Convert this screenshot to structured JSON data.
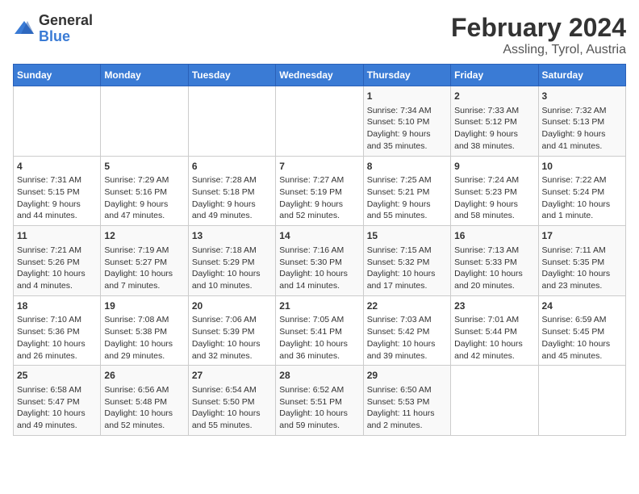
{
  "header": {
    "logo_general": "General",
    "logo_blue": "Blue",
    "title": "February 2024",
    "subtitle": "Assling, Tyrol, Austria"
  },
  "days_of_week": [
    "Sunday",
    "Monday",
    "Tuesday",
    "Wednesday",
    "Thursday",
    "Friday",
    "Saturday"
  ],
  "weeks": [
    [
      {
        "day": "",
        "info": ""
      },
      {
        "day": "",
        "info": ""
      },
      {
        "day": "",
        "info": ""
      },
      {
        "day": "",
        "info": ""
      },
      {
        "day": "1",
        "info": "Sunrise: 7:34 AM\nSunset: 5:10 PM\nDaylight: 9 hours\nand 35 minutes."
      },
      {
        "day": "2",
        "info": "Sunrise: 7:33 AM\nSunset: 5:12 PM\nDaylight: 9 hours\nand 38 minutes."
      },
      {
        "day": "3",
        "info": "Sunrise: 7:32 AM\nSunset: 5:13 PM\nDaylight: 9 hours\nand 41 minutes."
      }
    ],
    [
      {
        "day": "4",
        "info": "Sunrise: 7:31 AM\nSunset: 5:15 PM\nDaylight: 9 hours\nand 44 minutes."
      },
      {
        "day": "5",
        "info": "Sunrise: 7:29 AM\nSunset: 5:16 PM\nDaylight: 9 hours\nand 47 minutes."
      },
      {
        "day": "6",
        "info": "Sunrise: 7:28 AM\nSunset: 5:18 PM\nDaylight: 9 hours\nand 49 minutes."
      },
      {
        "day": "7",
        "info": "Sunrise: 7:27 AM\nSunset: 5:19 PM\nDaylight: 9 hours\nand 52 minutes."
      },
      {
        "day": "8",
        "info": "Sunrise: 7:25 AM\nSunset: 5:21 PM\nDaylight: 9 hours\nand 55 minutes."
      },
      {
        "day": "9",
        "info": "Sunrise: 7:24 AM\nSunset: 5:23 PM\nDaylight: 9 hours\nand 58 minutes."
      },
      {
        "day": "10",
        "info": "Sunrise: 7:22 AM\nSunset: 5:24 PM\nDaylight: 10 hours\nand 1 minute."
      }
    ],
    [
      {
        "day": "11",
        "info": "Sunrise: 7:21 AM\nSunset: 5:26 PM\nDaylight: 10 hours\nand 4 minutes."
      },
      {
        "day": "12",
        "info": "Sunrise: 7:19 AM\nSunset: 5:27 PM\nDaylight: 10 hours\nand 7 minutes."
      },
      {
        "day": "13",
        "info": "Sunrise: 7:18 AM\nSunset: 5:29 PM\nDaylight: 10 hours\nand 10 minutes."
      },
      {
        "day": "14",
        "info": "Sunrise: 7:16 AM\nSunset: 5:30 PM\nDaylight: 10 hours\nand 14 minutes."
      },
      {
        "day": "15",
        "info": "Sunrise: 7:15 AM\nSunset: 5:32 PM\nDaylight: 10 hours\nand 17 minutes."
      },
      {
        "day": "16",
        "info": "Sunrise: 7:13 AM\nSunset: 5:33 PM\nDaylight: 10 hours\nand 20 minutes."
      },
      {
        "day": "17",
        "info": "Sunrise: 7:11 AM\nSunset: 5:35 PM\nDaylight: 10 hours\nand 23 minutes."
      }
    ],
    [
      {
        "day": "18",
        "info": "Sunrise: 7:10 AM\nSunset: 5:36 PM\nDaylight: 10 hours\nand 26 minutes."
      },
      {
        "day": "19",
        "info": "Sunrise: 7:08 AM\nSunset: 5:38 PM\nDaylight: 10 hours\nand 29 minutes."
      },
      {
        "day": "20",
        "info": "Sunrise: 7:06 AM\nSunset: 5:39 PM\nDaylight: 10 hours\nand 32 minutes."
      },
      {
        "day": "21",
        "info": "Sunrise: 7:05 AM\nSunset: 5:41 PM\nDaylight: 10 hours\nand 36 minutes."
      },
      {
        "day": "22",
        "info": "Sunrise: 7:03 AM\nSunset: 5:42 PM\nDaylight: 10 hours\nand 39 minutes."
      },
      {
        "day": "23",
        "info": "Sunrise: 7:01 AM\nSunset: 5:44 PM\nDaylight: 10 hours\nand 42 minutes."
      },
      {
        "day": "24",
        "info": "Sunrise: 6:59 AM\nSunset: 5:45 PM\nDaylight: 10 hours\nand 45 minutes."
      }
    ],
    [
      {
        "day": "25",
        "info": "Sunrise: 6:58 AM\nSunset: 5:47 PM\nDaylight: 10 hours\nand 49 minutes."
      },
      {
        "day": "26",
        "info": "Sunrise: 6:56 AM\nSunset: 5:48 PM\nDaylight: 10 hours\nand 52 minutes."
      },
      {
        "day": "27",
        "info": "Sunrise: 6:54 AM\nSunset: 5:50 PM\nDaylight: 10 hours\nand 55 minutes."
      },
      {
        "day": "28",
        "info": "Sunrise: 6:52 AM\nSunset: 5:51 PM\nDaylight: 10 hours\nand 59 minutes."
      },
      {
        "day": "29",
        "info": "Sunrise: 6:50 AM\nSunset: 5:53 PM\nDaylight: 11 hours\nand 2 minutes."
      },
      {
        "day": "",
        "info": ""
      },
      {
        "day": "",
        "info": ""
      }
    ]
  ]
}
